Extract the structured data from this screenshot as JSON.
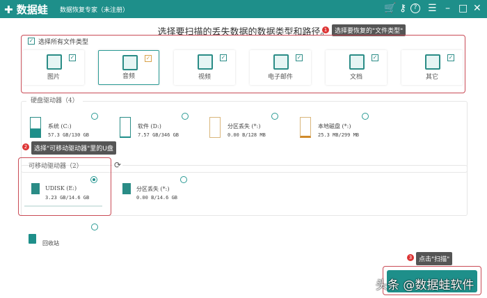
{
  "header": {
    "logo": "数据蛙",
    "subtitle": "数据恢复专家（未注册）",
    "buttons": {
      "cart": "🛒",
      "key": "⚷",
      "help": "?",
      "menu": "☰",
      "minimize": "–",
      "maximize": "□",
      "close": "✕"
    }
  },
  "title": "选择要扫描的丢失数据的数据类型和路径。",
  "tips": [
    {
      "num": "1",
      "text": "选择要恢复的\"文件类型\""
    },
    {
      "num": "2",
      "text": "选择\"可移动驱动器\"里的U盘"
    },
    {
      "num": "3",
      "text": "点击\"扫描\""
    }
  ],
  "filetypes": {
    "select_all": "选择所有文件类型",
    "items": [
      {
        "label": "图片",
        "checked": true
      },
      {
        "label": "音频",
        "checked": true
      },
      {
        "label": "视频",
        "checked": true
      },
      {
        "label": "电子邮件",
        "checked": true
      },
      {
        "label": "文档",
        "checked": true
      },
      {
        "label": "其它",
        "checked": true
      }
    ]
  },
  "hard_drives": {
    "label": "硬盘驱动器（4）",
    "items": [
      {
        "name": "系统 (C:)",
        "size": "57.3 GB/130 GB",
        "fill": 0.44
      },
      {
        "name": "软件 (D:)",
        "size": "7.57 GB/346 GB",
        "fill": 0.02
      },
      {
        "name": "分区丢失 (*:)",
        "size": "0.00  B/128 MB",
        "fill": 0
      },
      {
        "name": "本地磁盘 (*:)",
        "size": "25.3 MB/299 MB",
        "fill": 0.08
      }
    ]
  },
  "removable": {
    "label": "可移动驱动器（2）",
    "items": [
      {
        "name": "UDISK (E:)",
        "size": "3.23 GB/14.6 GB",
        "selected": true
      },
      {
        "name": "分区丢失 (*:)",
        "size": "0.00  B/14.6 GB",
        "selected": false
      }
    ]
  },
  "recycle": {
    "label": "回收站"
  },
  "scan_button": "扫描",
  "watermark": "头条 @数据蛙软件",
  "colors": {
    "brand": "#1e8f8a",
    "highlight": "#c94a55"
  }
}
